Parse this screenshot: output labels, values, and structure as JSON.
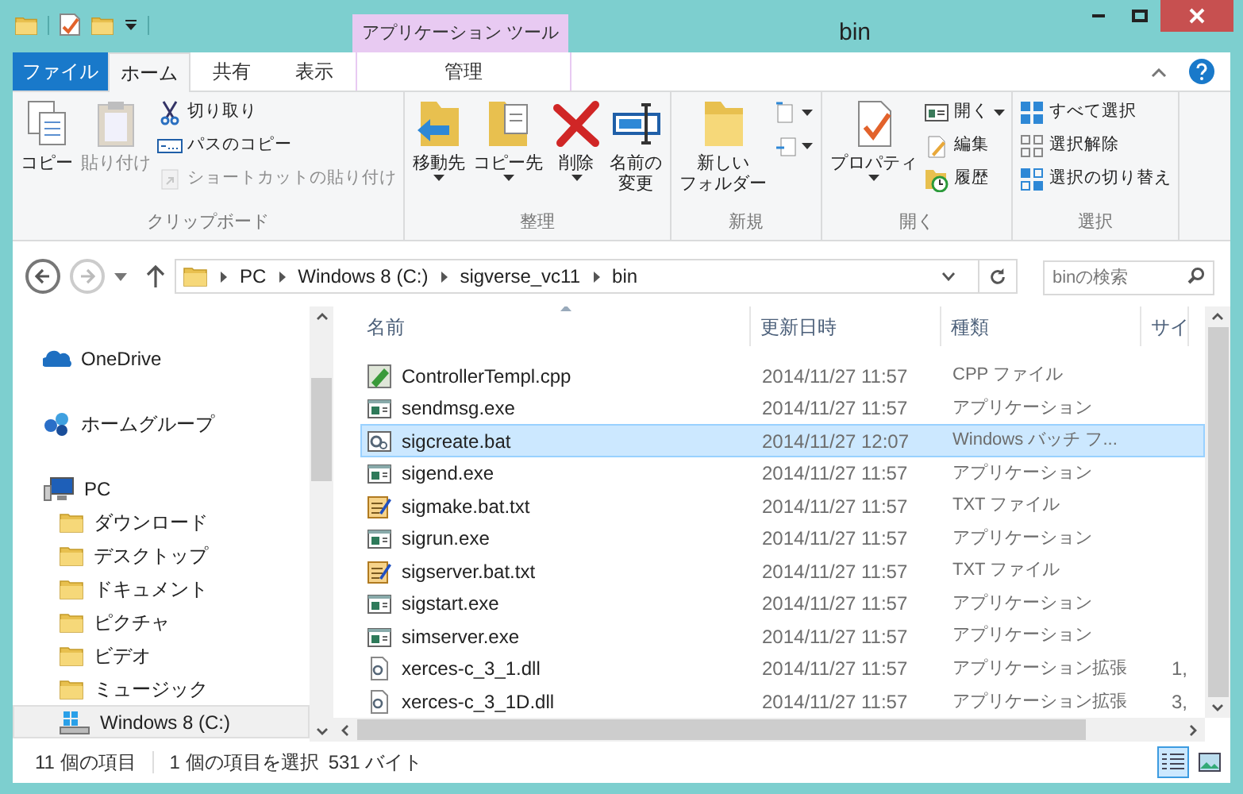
{
  "window": {
    "title": "bin",
    "contextual_group": "アプリケーション ツール"
  },
  "tabs": [
    {
      "label": "ファイル",
      "kind": "file",
      "selected": false
    },
    {
      "label": "ホーム",
      "kind": "normal",
      "selected": true
    },
    {
      "label": "共有",
      "kind": "normal",
      "selected": false
    },
    {
      "label": "表示",
      "kind": "normal",
      "selected": false
    },
    {
      "label": "管理",
      "kind": "contextual",
      "selected": false
    }
  ],
  "ribbon": [
    {
      "label": "クリップボード",
      "items": [
        {
          "label": "コピー",
          "kind": "large",
          "dropdown": false,
          "disabled": false
        },
        {
          "label": "貼り付け",
          "kind": "large",
          "dropdown": false,
          "disabled": true
        },
        {
          "label": "切り取り",
          "kind": "small",
          "dropdown": false,
          "disabled": false
        },
        {
          "label": "パスのコピー",
          "kind": "small",
          "dropdown": false,
          "disabled": false
        },
        {
          "label": "ショートカットの貼り付け",
          "kind": "small",
          "dropdown": false,
          "disabled": true
        }
      ]
    },
    {
      "label": "整理",
      "items": [
        {
          "label": "移動先",
          "kind": "large",
          "dropdown": true,
          "disabled": false
        },
        {
          "label": "コピー先",
          "kind": "large",
          "dropdown": true,
          "disabled": false
        },
        {
          "label": "削除",
          "kind": "large",
          "dropdown": true,
          "disabled": false
        },
        {
          "lines": [
            "名前の",
            "変更"
          ],
          "kind": "large",
          "dropdown": false,
          "disabled": false
        }
      ]
    },
    {
      "label": "新規",
      "items": [
        {
          "lines": [
            "新しい",
            "フォルダー"
          ],
          "kind": "large",
          "dropdown": false,
          "disabled": false
        },
        {
          "kind": "icon",
          "dropdown": true,
          "disabled": false
        },
        {
          "kind": "icon",
          "dropdown": true,
          "disabled": false
        }
      ]
    },
    {
      "label": "開く",
      "items": [
        {
          "label": "プロパティ",
          "kind": "large",
          "dropdown": true,
          "disabled": false
        },
        {
          "label": "開く",
          "kind": "small",
          "dropdown": true,
          "disabled": false
        },
        {
          "label": "編集",
          "kind": "small",
          "dropdown": false,
          "disabled": false
        },
        {
          "label": "履歴",
          "kind": "small",
          "dropdown": false,
          "disabled": false
        }
      ]
    },
    {
      "label": "選択",
      "items": [
        {
          "label": "すべて選択",
          "kind": "small",
          "dropdown": false,
          "disabled": false
        },
        {
          "label": "選択解除",
          "kind": "small",
          "dropdown": false,
          "disabled": false
        },
        {
          "label": "選択の切り替え",
          "kind": "small",
          "dropdown": false,
          "disabled": false
        }
      ]
    }
  ],
  "address": {
    "breadcrumbs": [
      "PC",
      "Windows 8 (C:)",
      "sigverse_vc11",
      "bin"
    ]
  },
  "search": {
    "placeholder": "binの検索"
  },
  "sidebar": {
    "items": [
      {
        "label": "OneDrive",
        "kind": "cloud",
        "selected": false
      },
      {
        "label": "ホームグループ",
        "kind": "homegroup",
        "selected": false
      },
      {
        "label": "PC",
        "kind": "pc",
        "selected": false,
        "children": [
          {
            "label": "ダウンロード",
            "kind": "folder",
            "selected": false
          },
          {
            "label": "デスクトップ",
            "kind": "folder",
            "selected": false
          },
          {
            "label": "ドキュメント",
            "kind": "folder",
            "selected": false
          },
          {
            "label": "ピクチャ",
            "kind": "folder",
            "selected": false
          },
          {
            "label": "ビデオ",
            "kind": "folder",
            "selected": false
          },
          {
            "label": "ミュージック",
            "kind": "folder",
            "selected": false
          },
          {
            "label": "Windows 8 (C:)",
            "kind": "drive",
            "selected": true
          }
        ]
      }
    ]
  },
  "table": {
    "columns": [
      "名前",
      "更新日時",
      "種類",
      "サイ"
    ],
    "rows": [
      {
        "kind": "source",
        "name": "ControllerTempl.cpp",
        "date": "2014/11/27 11:57",
        "type": "CPP ファイル",
        "selected": false
      },
      {
        "kind": "application",
        "name": "sendmsg.exe",
        "date": "2014/11/27 11:57",
        "type": "アプリケーション",
        "selected": false
      },
      {
        "kind": "batch",
        "name": "sigcreate.bat",
        "date": "2014/11/27 12:07",
        "type": "Windows バッチ フ...",
        "selected": true
      },
      {
        "kind": "application",
        "name": "sigend.exe",
        "date": "2014/11/27 11:57",
        "type": "アプリケーション",
        "selected": false
      },
      {
        "kind": "text",
        "name": "sigmake.bat.txt",
        "date": "2014/11/27 11:57",
        "type": "TXT ファイル",
        "selected": false
      },
      {
        "kind": "application",
        "name": "sigrun.exe",
        "date": "2014/11/27 11:57",
        "type": "アプリケーション",
        "selected": false
      },
      {
        "kind": "text",
        "name": "sigserver.bat.txt",
        "date": "2014/11/27 11:57",
        "type": "TXT ファイル",
        "selected": false
      },
      {
        "kind": "application",
        "name": "sigstart.exe",
        "date": "2014/11/27 11:57",
        "type": "アプリケーション",
        "selected": false
      },
      {
        "kind": "application",
        "name": "simserver.exe",
        "date": "2014/11/27 11:57",
        "type": "アプリケーション",
        "selected": false
      },
      {
        "kind": "library",
        "name": "xerces-c_3_1.dll",
        "date": "2014/11/27 11:57",
        "type": "アプリケーション拡張",
        "size": "1,",
        "selected": false
      },
      {
        "kind": "library",
        "name": "xerces-c_3_1D.dll",
        "date": "2014/11/27 11:57",
        "type": "アプリケーション拡張",
        "size": "3,",
        "selected": false
      }
    ]
  },
  "status_bar": {
    "count": "11 個の項目",
    "selection": "1 個の項目を選択",
    "size": "531 バイト"
  },
  "views": [
    {
      "kind": "details",
      "selected": true
    },
    {
      "kind": "large-icons",
      "selected": false
    }
  ]
}
